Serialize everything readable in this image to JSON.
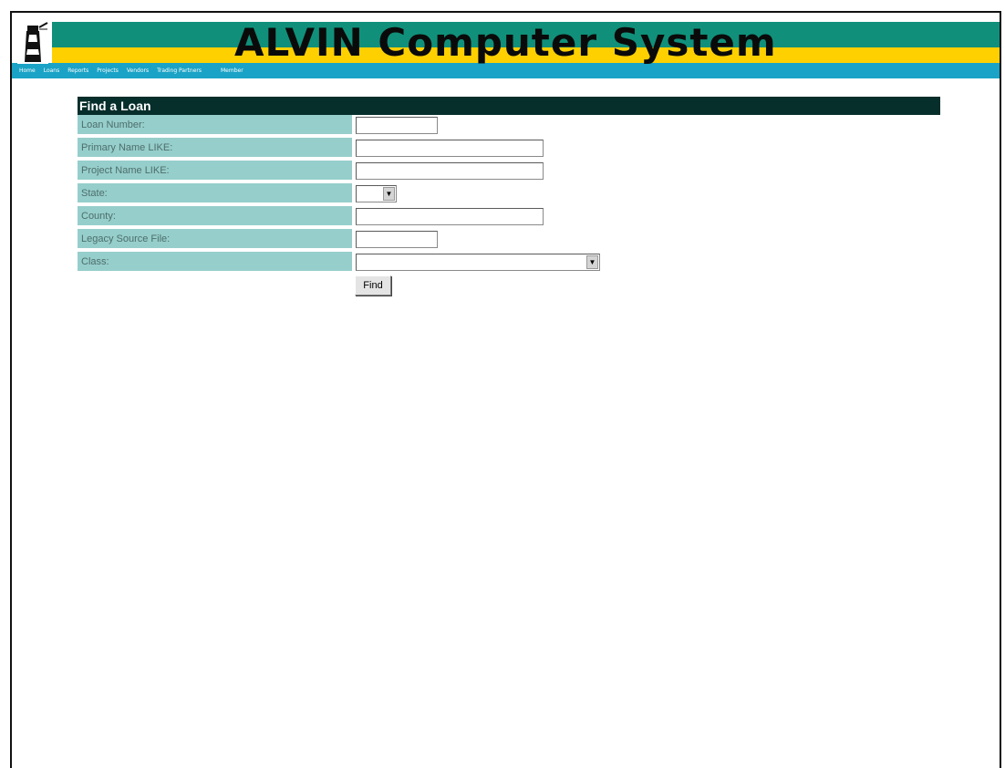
{
  "header": {
    "title": "ALVIN Computer System",
    "colors": {
      "green": "#10907a",
      "yellow": "#ffd000",
      "blue": "#1aa3c6"
    }
  },
  "nav": {
    "items": [
      {
        "label": "Home"
      },
      {
        "label": "Loans"
      },
      {
        "label": "Reports"
      },
      {
        "label": "Projects"
      },
      {
        "label": "Vendors"
      },
      {
        "label": "Trading Partners"
      },
      {
        "label": "Member"
      }
    ]
  },
  "form": {
    "title": "Find a Loan",
    "fields": {
      "loan_number": {
        "label": "Loan Number:",
        "value": ""
      },
      "primary_name": {
        "label": "Primary Name LIKE:",
        "value": ""
      },
      "project_name": {
        "label": "Project Name LIKE:",
        "value": ""
      },
      "state": {
        "label": "State:",
        "value": ""
      },
      "county": {
        "label": "County:",
        "value": ""
      },
      "legacy_source_file": {
        "label": "Legacy Source File:",
        "value": ""
      },
      "class": {
        "label": "Class:",
        "value": ""
      }
    },
    "find_label": "Find"
  }
}
